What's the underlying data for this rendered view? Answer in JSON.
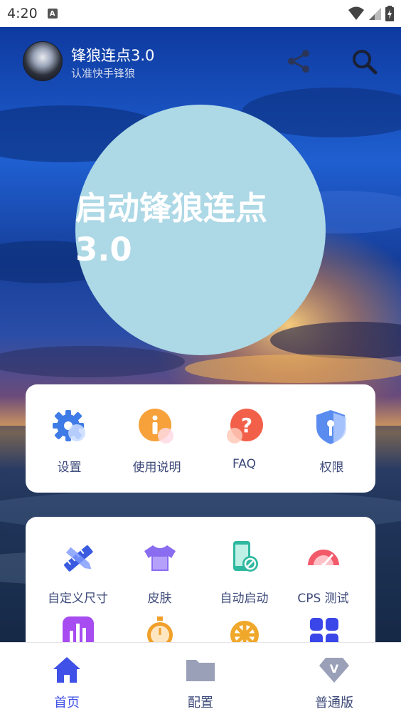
{
  "status_bar": {
    "time": "4:20",
    "notification_glyph": "A"
  },
  "header": {
    "title": "锋狼连点3.0",
    "subtitle": "认准快手锋狼",
    "icons": [
      "share-icon",
      "search-icon"
    ]
  },
  "start_button": {
    "label": "启动锋狼连点3.0",
    "color": "#add8e6"
  },
  "quick_actions": [
    {
      "label": "设置",
      "icon": "gear-icon"
    },
    {
      "label": "使用说明",
      "icon": "info-icon"
    },
    {
      "label": "FAQ",
      "icon": "question-icon"
    },
    {
      "label": "权限",
      "icon": "shield-key-icon"
    }
  ],
  "tools": [
    {
      "label": "自定义尺寸",
      "icon": "pencil-ruler-icon"
    },
    {
      "label": "皮肤",
      "icon": "tshirt-icon"
    },
    {
      "label": "自动启动",
      "icon": "phone-link-icon"
    },
    {
      "label": "CPS 测试",
      "icon": "speedometer-icon"
    },
    {
      "label": "",
      "icon": "bar-chart-icon"
    },
    {
      "label": "",
      "icon": "stopwatch-icon"
    },
    {
      "label": "",
      "icon": "wheel-icon"
    },
    {
      "label": "",
      "icon": "apps-grid-icon"
    }
  ],
  "bottom_nav": [
    {
      "label": "首页",
      "icon": "home-icon",
      "active": true
    },
    {
      "label": "配置",
      "icon": "folder-icon",
      "active": false
    },
    {
      "label": "普通版",
      "icon": "diamond-v-icon",
      "active": false
    }
  ],
  "colors": {
    "accent": "#3f51e6",
    "inactive": "#8a8fa8",
    "label": "#3d4a7a",
    "circle": "#add8e6"
  }
}
